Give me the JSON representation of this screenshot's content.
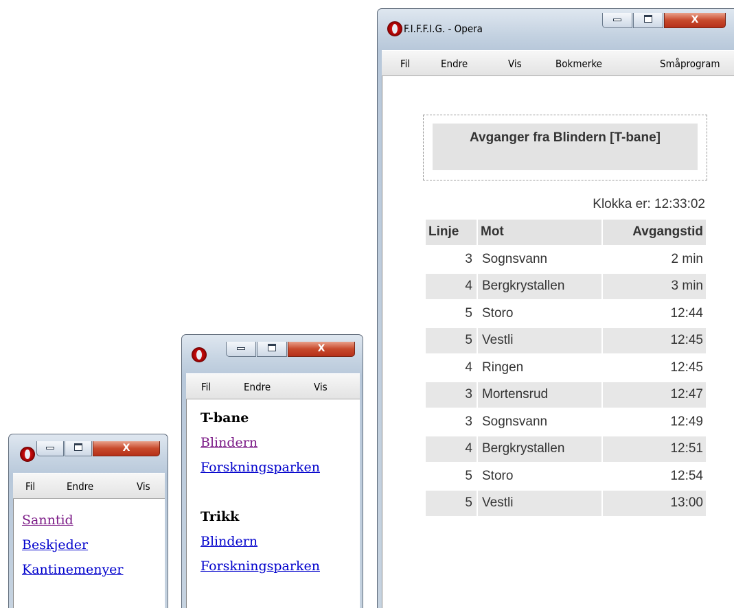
{
  "windows": {
    "small": {
      "menu": [
        "Fil",
        "Endre",
        "Vis"
      ],
      "links": [
        {
          "label": "Sanntid",
          "visited": true
        },
        {
          "label": "Beskjeder",
          "visited": false
        },
        {
          "label": "Kantinemenyer",
          "visited": false
        }
      ]
    },
    "medium": {
      "menu": [
        "Fil",
        "Endre",
        "Vis"
      ],
      "sections": [
        {
          "heading": "T-bane",
          "links": [
            {
              "label": "Blindern",
              "visited": true
            },
            {
              "label": "Forskningsparken",
              "visited": false
            }
          ]
        },
        {
          "heading": "Trikk",
          "links": [
            {
              "label": "Blindern",
              "visited": false
            },
            {
              "label": "Forskningsparken",
              "visited": false
            }
          ]
        }
      ]
    },
    "large": {
      "title": "F.I.F.F.I.G. - Opera",
      "menu": [
        "Fil",
        "Endre",
        "Vis",
        "Bokmerke",
        "Småprogram"
      ],
      "departures_title": "Avganger fra Blindern [T-bane]",
      "clock": "Klokka er: 12:33:02",
      "table": {
        "headers": [
          "Linje",
          "Mot",
          "Avgangstid"
        ],
        "rows": [
          {
            "line": "3",
            "to": "Sognsvann",
            "time": "2 min"
          },
          {
            "line": "4",
            "to": "Bergkrystallen",
            "time": "3 min"
          },
          {
            "line": "5",
            "to": "Storo",
            "time": "12:44"
          },
          {
            "line": "5",
            "to": "Vestli",
            "time": "12:45"
          },
          {
            "line": "4",
            "to": "Ringen",
            "time": "12:45"
          },
          {
            "line": "3",
            "to": "Mortensrud",
            "time": "12:47"
          },
          {
            "line": "3",
            "to": "Sognsvann",
            "time": "12:49"
          },
          {
            "line": "4",
            "to": "Bergkrystallen",
            "time": "12:51"
          },
          {
            "line": "5",
            "to": "Storo",
            "time": "12:54"
          },
          {
            "line": "5",
            "to": "Vestli",
            "time": "13:00"
          }
        ]
      }
    }
  },
  "window_controls": {
    "minimize": "minimize-icon",
    "maximize": "maximize-icon",
    "close": "close-icon",
    "close_glyph": "X"
  },
  "colors": {
    "link": "#0000cc",
    "visited_link": "#7b1a86",
    "row_shade": "#e7e7e7",
    "close_button": "#c84a2c"
  }
}
